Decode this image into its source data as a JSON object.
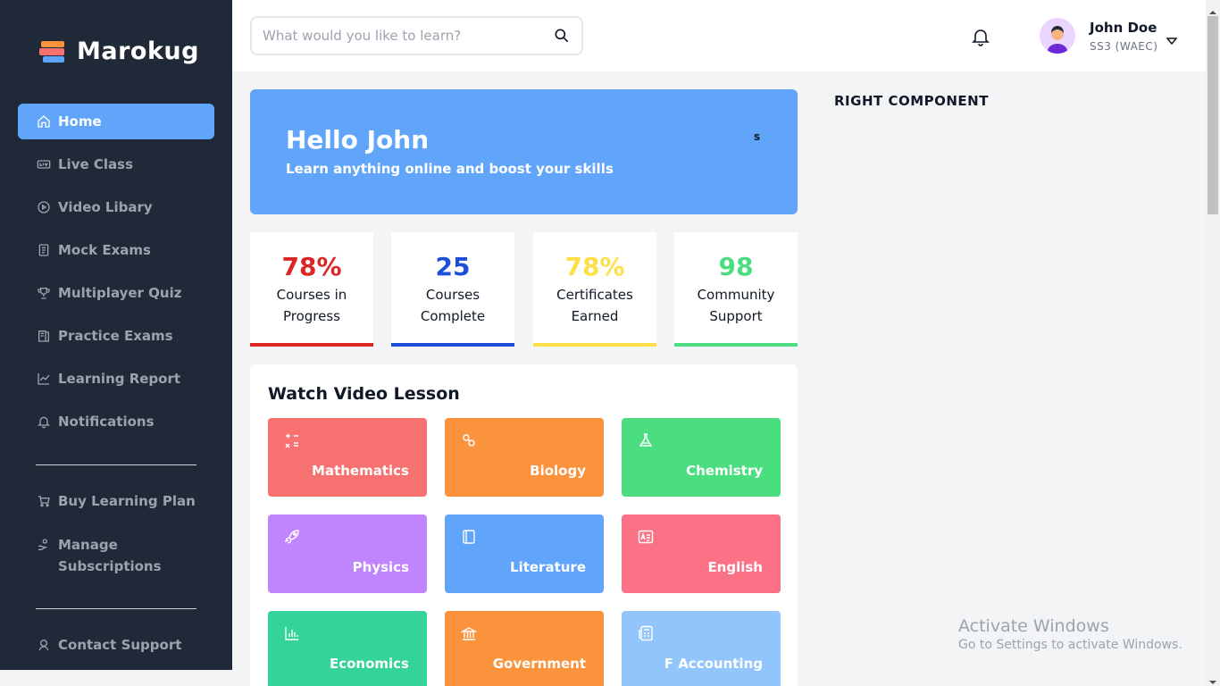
{
  "brand": {
    "name": "Marokug"
  },
  "sidebar": {
    "items": [
      {
        "label": "Home",
        "icon": "home-icon"
      },
      {
        "label": "Live Class",
        "icon": "live-icon"
      },
      {
        "label": "Video Libary",
        "icon": "video-icon"
      },
      {
        "label": "Mock Exams",
        "icon": "document-icon"
      },
      {
        "label": "Multiplayer Quiz",
        "icon": "trophy-icon"
      },
      {
        "label": "Practice Exams",
        "icon": "book-icon"
      },
      {
        "label": "Learning Report",
        "icon": "chart-icon"
      },
      {
        "label": "Notifications",
        "icon": "bell-icon"
      }
    ],
    "secondary": [
      {
        "label": "Buy Learning Plan",
        "icon": "cart-icon"
      },
      {
        "label": "Manage Subscriptions",
        "icon": "subscription-icon"
      }
    ],
    "support": {
      "label": "Contact Support",
      "icon": "support-icon"
    },
    "active_color": "#60a5fa"
  },
  "search": {
    "placeholder": "What would you like to learn?"
  },
  "user": {
    "name": "John Doe",
    "class": "SS3 (WAEC)"
  },
  "hero": {
    "title": "Hello John",
    "subtitle": "Learn anything online and boost your skills",
    "badge": "s"
  },
  "stats": [
    {
      "value": "78%",
      "label_line1": "Courses in",
      "label_line2": "Progress",
      "color": "#dc2626"
    },
    {
      "value": "25",
      "label_line1": "Courses",
      "label_line2": "Complete",
      "color": "#1d4ed8"
    },
    {
      "value": "78%",
      "label_line1": "Certificates",
      "label_line2": "Earned",
      "color": "#fde047"
    },
    {
      "value": "98",
      "label_line1": "Community",
      "label_line2": "Support",
      "color": "#4ade80"
    }
  ],
  "videos": {
    "title": "Watch Video Lesson",
    "subjects": [
      {
        "name": "Mathematics",
        "icon": "math-icon",
        "color": "#f87171"
      },
      {
        "name": "Biology",
        "icon": "biology-icon",
        "color": "#fb923c"
      },
      {
        "name": "Chemistry",
        "icon": "flask-icon",
        "color": "#4ade80"
      },
      {
        "name": "Physics",
        "icon": "rocket-icon",
        "color": "#c084fc"
      },
      {
        "name": "Literature",
        "icon": "book-icon",
        "color": "#60a5fa"
      },
      {
        "name": "English",
        "icon": "language-icon",
        "color": "#fb7185"
      },
      {
        "name": "Economics",
        "icon": "bar-chart-icon",
        "color": "#34d399"
      },
      {
        "name": "Government",
        "icon": "building-icon",
        "color": "#fb923c"
      },
      {
        "name": "F Accounting",
        "icon": "calculator-icon",
        "color": "#93c5fd"
      }
    ]
  },
  "right": {
    "title": "RIGHT COMPONENT"
  },
  "windows_notice": {
    "line1": "Activate Windows",
    "line2": "Go to Settings to activate Windows."
  }
}
